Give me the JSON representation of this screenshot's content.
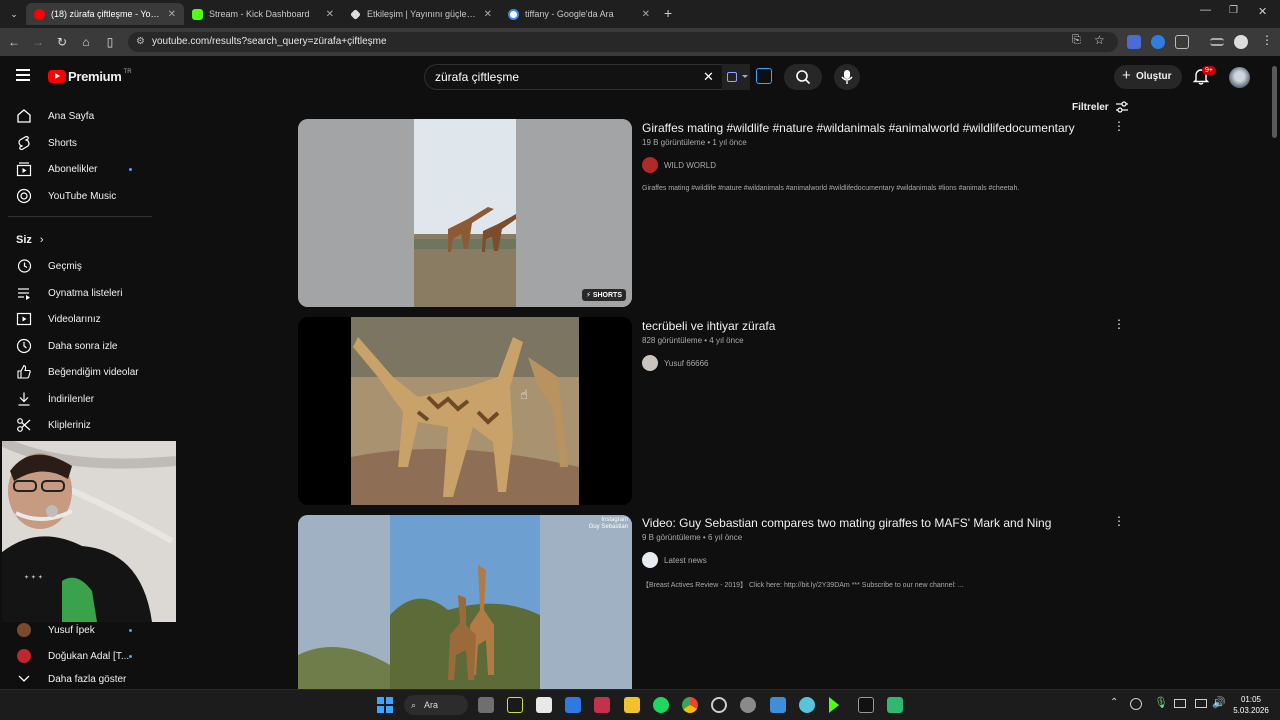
{
  "tabs": [
    {
      "title": "(18) zürafa çiftleşme - YouTube",
      "color": "#ff0000"
    },
    {
      "title": "Stream - Kick Dashboard",
      "color": "#53fc18"
    },
    {
      "title": "Etkileşim | Yayınını güçlendirme",
      "color": "#ffffff"
    },
    {
      "title": "tiffany - Google'da Ara",
      "color": "#4285f4"
    }
  ],
  "address": {
    "url": "youtube.com/results?search_query=zürafa+çiftleşme"
  },
  "header": {
    "logo_text": "Premium",
    "logo_region": "TR",
    "search_value": "zürafa çiftleşme",
    "create_label": "Oluştur",
    "notif_badge": "9+"
  },
  "filters_label": "Filtreler",
  "sidebar": {
    "main": [
      {
        "label": "Ana Sayfa",
        "icon": "home-icon"
      },
      {
        "label": "Shorts",
        "icon": "shorts-icon"
      },
      {
        "label": "Abonelikler",
        "icon": "subscriptions-icon"
      },
      {
        "label": "YouTube Music",
        "icon": "music-icon"
      }
    ],
    "you_heading": "Siz",
    "you": [
      {
        "label": "Geçmiş",
        "icon": "history-icon"
      },
      {
        "label": "Oynatma listeleri",
        "icon": "playlist-icon"
      },
      {
        "label": "Videolarınız",
        "icon": "your-videos-icon"
      },
      {
        "label": "Daha sonra izle",
        "icon": "watch-later-icon"
      },
      {
        "label": "Beğendiğim videolar",
        "icon": "like-icon"
      },
      {
        "label": "İndirilenler",
        "icon": "download-icon"
      },
      {
        "label": "Klipleriniz",
        "icon": "clips-icon"
      }
    ],
    "subs": [
      {
        "label": "Yusuf İpek"
      },
      {
        "label": "Doğukan Adal [T..."
      }
    ],
    "show_more": "Daha fazla göster"
  },
  "results": [
    {
      "title": "Giraffes mating #wildlife #nature #wildanimals #animalworld #wildlifedocumentary",
      "meta": "19 B görüntüleme • 1 yıl önce",
      "channel": "WILD WORLD",
      "description": "Giraffes mating #wildlife #nature #wildanimals #animalworld #wildlifedocumentary #wildanimals #lions #animals #cheetah.",
      "badge": "SHORTS"
    },
    {
      "title": "tecrübeli ve ihtiyar zürafa",
      "meta": "828 görüntüleme • 4 yıl önce",
      "channel": "Yusuf 66666",
      "description": ""
    },
    {
      "title": "Video: Guy Sebastian compares two mating giraffes to MAFS' Mark and Ning",
      "meta": "9 B görüntüleme • 6 yıl önce",
      "channel": "Latest news",
      "description": "【Breast Actives Review - 2019】 Click here: http://bit.ly/2Y39DAm *** Subscribe to our new channel: ...",
      "watermark1": "Instagram",
      "watermark2": "Guy Sebastian"
    }
  ],
  "taskbar": {
    "search_label": "Ara",
    "time": "01:05",
    "date": "5.03.2026"
  }
}
